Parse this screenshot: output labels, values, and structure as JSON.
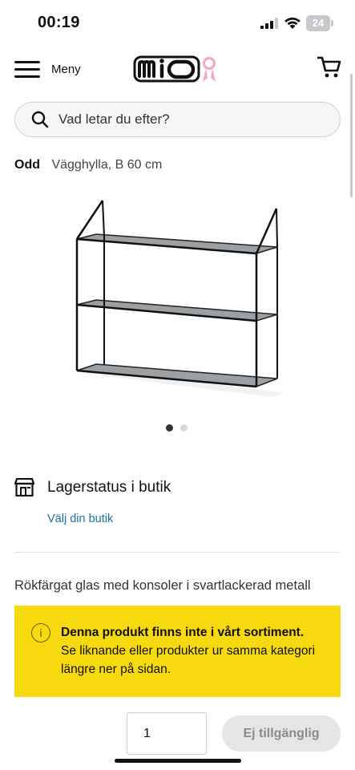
{
  "status_bar": {
    "time": "00:19",
    "battery": "24"
  },
  "header": {
    "menu_label": "Meny",
    "logo_text": "mio"
  },
  "search": {
    "placeholder": "Vad letar du efter?"
  },
  "product": {
    "brand": "Odd",
    "name": "Vägghylla, B 60 cm",
    "image_count": 2,
    "active_image": 1,
    "description": "Rökfärgat glas med konsoler i svartlackerad metall"
  },
  "stock": {
    "title": "Lagerstatus i butik",
    "choose_store": "Välj din butik"
  },
  "notice": {
    "title": "Denna produkt finns inte i vårt sortiment.",
    "body": "Se liknande eller produkter ur samma kategori längre ner på sidan.",
    "info_icon": "i"
  },
  "purchase": {
    "quantity": "1",
    "button_label": "Ej tillgänglig"
  },
  "colors": {
    "notice_bg": "#f7d90f",
    "link": "#1a6fa3",
    "button_disabled": "#e5e5e5",
    "logo_ribbon": "#f2a6c0"
  }
}
